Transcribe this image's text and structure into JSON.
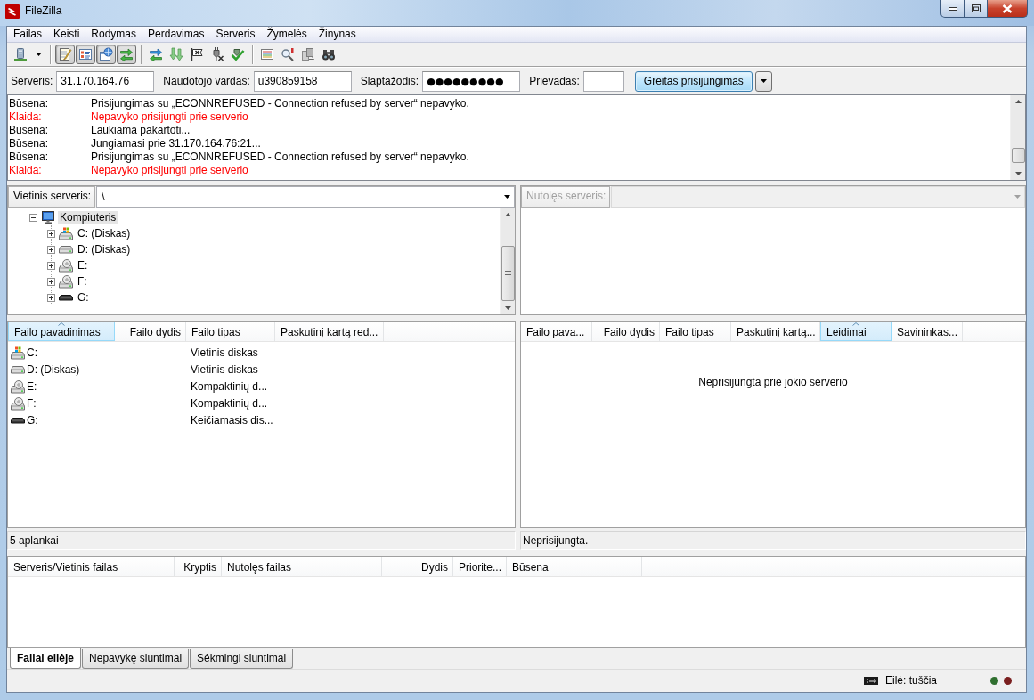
{
  "window": {
    "title": "FileZilla"
  },
  "menu": [
    {
      "label": "Failas"
    },
    {
      "label": "Keisti"
    },
    {
      "label": "Rodymas"
    },
    {
      "label": "Perdavimas"
    },
    {
      "label": "Serveris"
    },
    {
      "label": "Žymelės"
    },
    {
      "label": "Žinynas"
    }
  ],
  "toolbar": {
    "start": [
      {
        "kind": "sitemanager"
      }
    ],
    "toggles": [
      {
        "kind": "log",
        "on": true
      },
      {
        "kind": "localtree",
        "on": true
      },
      {
        "kind": "remotetree",
        "on": true
      },
      {
        "kind": "queue",
        "on": true
      }
    ],
    "actions": [
      {
        "kind": "refresh"
      },
      {
        "kind": "process"
      },
      {
        "kind": "cancel"
      },
      {
        "kind": "disconnect"
      },
      {
        "kind": "reconnect"
      }
    ],
    "tools": [
      {
        "kind": "filter"
      },
      {
        "kind": "compare"
      },
      {
        "kind": "sync"
      },
      {
        "kind": "search"
      }
    ]
  },
  "quickconnect": {
    "host": {
      "label": "Serveris:",
      "value": "31.170.164.76"
    },
    "username": {
      "label": "Naudotojo vardas:",
      "value": "u390859158"
    },
    "password": {
      "label": "Slaptažodis:",
      "value": "●●●●●●●●●"
    },
    "port": {
      "label": "Prievadas:"
    },
    "connect_button": {
      "label": "Greitas prisijungimas"
    }
  },
  "message_log": [
    {
      "kind": "status",
      "prefix": "Būsena:",
      "text": "Prisijungimas su „ECONNREFUSED - Connection refused by server“ nepavyko."
    },
    {
      "kind": "error",
      "prefix": "Klaida:",
      "text": "Nepavyko prisijungti prie serverio"
    },
    {
      "kind": "status",
      "prefix": "Būsena:",
      "text": "Laukiama pakartoti..."
    },
    {
      "kind": "status",
      "prefix": "Būsena:",
      "text": "Jungiamasi prie 31.170.164.76:21..."
    },
    {
      "kind": "status",
      "prefix": "Būsena:",
      "text": "Prisijungimas su „ECONNREFUSED - Connection refused by server“ nepavyko."
    },
    {
      "kind": "error",
      "prefix": "Klaida:",
      "text": "Nepavyko prisijungti prie serverio"
    }
  ],
  "local_site": {
    "label": "Vietinis serveris:",
    "path": "\\"
  },
  "local_tree": [
    {
      "label": "Kompiuteris",
      "kind": "computer",
      "expanded": true,
      "selected": true,
      "children": [
        {
          "label": "C: (Diskas)",
          "kind": "system",
          "expanded": false,
          "selected": false
        },
        {
          "label": "D: (Diskas)",
          "kind": "disk",
          "expanded": false,
          "selected": false
        },
        {
          "label": "E:",
          "kind": "cdrom",
          "expanded": false,
          "selected": false
        },
        {
          "label": "F:",
          "kind": "cdrom",
          "expanded": false,
          "selected": false
        },
        {
          "label": "G:",
          "kind": "removable",
          "expanded": false,
          "selected": false
        }
      ]
    }
  ],
  "remote_site": {
    "label": "Nutolęs serveris:",
    "disabled": true
  },
  "local_files": {
    "columns": [
      {
        "label": "Failo pavadinimas",
        "sorted": true
      },
      {
        "label": "Failo dydis",
        "sorted": false
      },
      {
        "label": "Failo tipas",
        "sorted": false
      },
      {
        "label": "Paskutinį kartą red...",
        "sorted": false
      }
    ],
    "rows": [
      {
        "kind": "system",
        "name": "C:",
        "type": "Vietinis diskas"
      },
      {
        "kind": "disk",
        "name": "D: (Diskas)",
        "type": "Vietinis diskas"
      },
      {
        "kind": "cdrom",
        "name": "E:",
        "type": "Kompaktinių d..."
      },
      {
        "kind": "cdrom",
        "name": "F:",
        "type": "Kompaktinių d..."
      },
      {
        "kind": "removable",
        "name": "G:",
        "type": "Keičiamasis dis..."
      }
    ],
    "status": "5 aplankai"
  },
  "remote_files": {
    "columns": [
      {
        "label": "Failo pava...",
        "sorted": false
      },
      {
        "label": "Failo dydis",
        "sorted": false
      },
      {
        "label": "Failo tipas",
        "sorted": false
      },
      {
        "label": "Paskutinį kartą...",
        "sorted": false
      },
      {
        "label": "Leidimai",
        "sorted": true
      },
      {
        "label": "Savininkas...",
        "sorted": false
      }
    ],
    "empty_message": "Neprisijungta prie jokio serverio",
    "status": "Neprisijungta."
  },
  "queue": {
    "columns": [
      {
        "label": "Serveris/Vietinis failas"
      },
      {
        "label": "Kryptis"
      },
      {
        "label": "Nutolęs failas"
      },
      {
        "label": "Dydis"
      },
      {
        "label": "Priorite..."
      },
      {
        "label": "Būsena"
      }
    ],
    "tabs": [
      {
        "label": "Failai eilėje",
        "selected": true
      },
      {
        "label": "Nepavykę siuntimai",
        "selected": false
      },
      {
        "label": "Sėkmingi siuntimai",
        "selected": false
      }
    ]
  },
  "status_bar": {
    "queue_text": "Eilė: tuščia",
    "lights": [
      {
        "color": "#2f6f2f"
      },
      {
        "color": "#7a1f1f"
      }
    ]
  }
}
